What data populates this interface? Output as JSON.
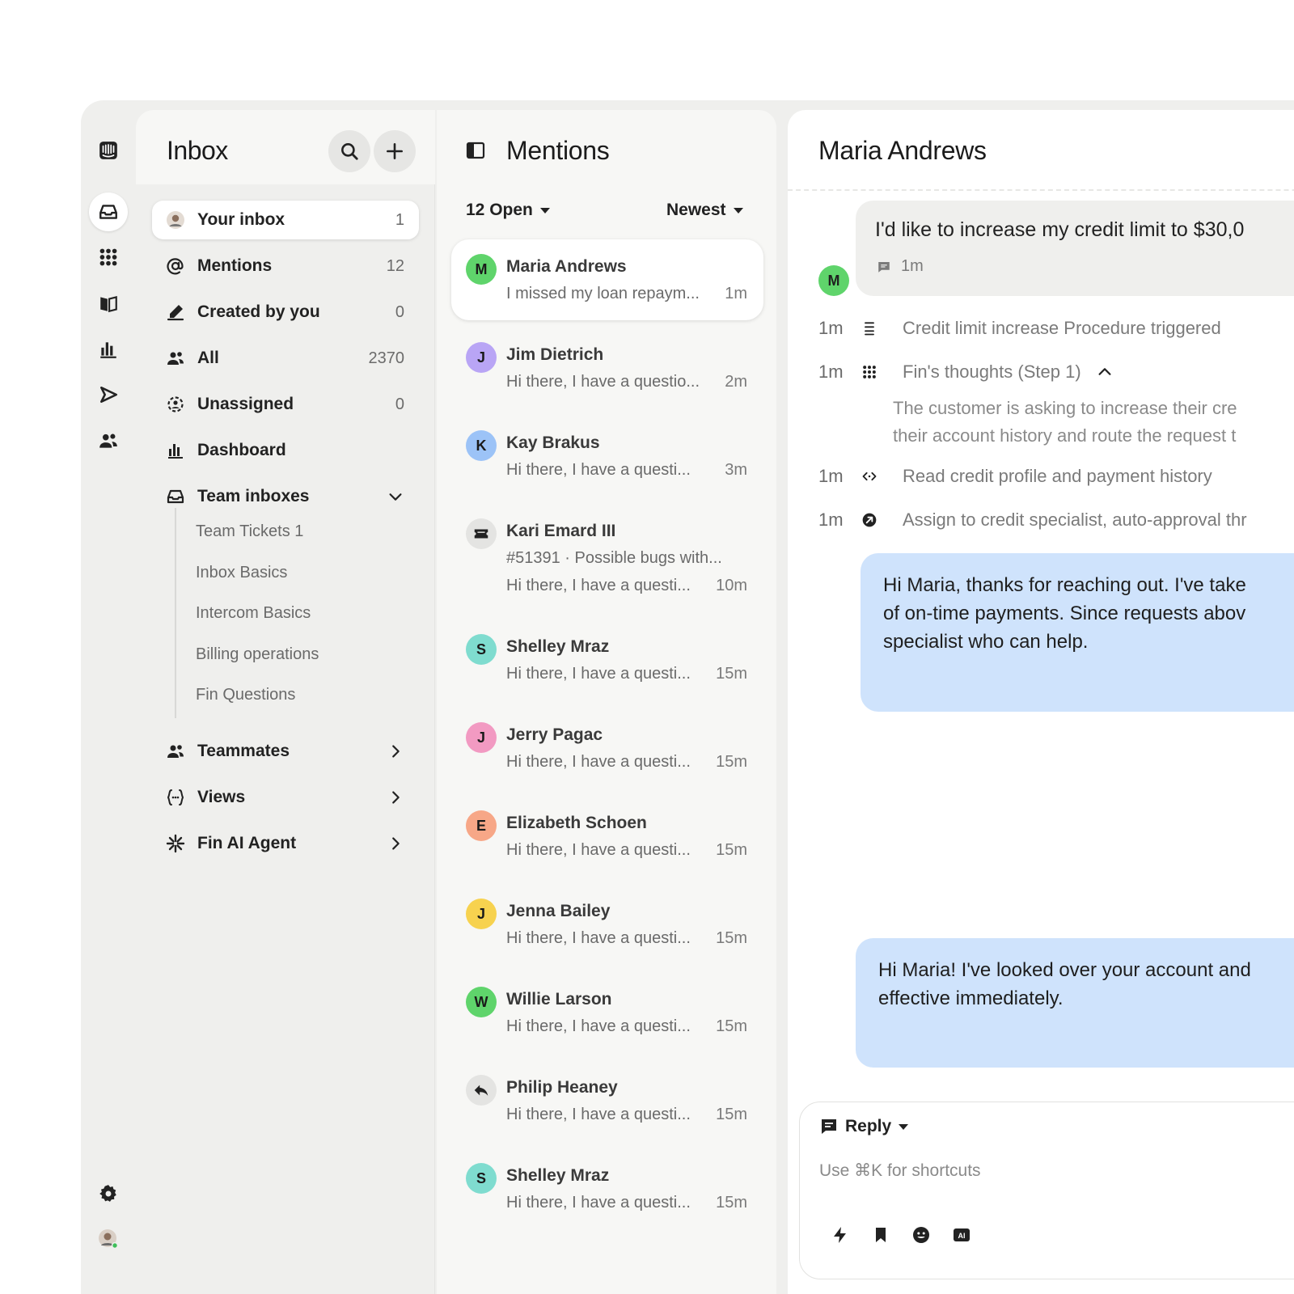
{
  "rail": {
    "icons": [
      "intercom-logo-icon",
      "inbox-icon",
      "fin-icon",
      "knowledge-book-icon",
      "reports-icon",
      "outbound-icon",
      "contacts-icon",
      "settings-icon",
      "user-avatar"
    ]
  },
  "nav": {
    "title": "Inbox",
    "items": [
      {
        "label": "Your inbox",
        "count": "1"
      },
      {
        "label": "Mentions",
        "count": "12"
      },
      {
        "label": "Created by you",
        "count": "0"
      },
      {
        "label": "All",
        "count": "2370"
      },
      {
        "label": "Unassigned",
        "count": "0"
      },
      {
        "label": "Dashboard",
        "count": ""
      },
      {
        "label": "Team inboxes",
        "count": ""
      }
    ],
    "team_inboxes": [
      "Team Tickets 1",
      "Inbox Basics",
      "Intercom Basics",
      "Billing operations",
      "Fin Questions"
    ],
    "groups": [
      {
        "label": "Teammates"
      },
      {
        "label": "Views"
      },
      {
        "label": "Fin AI Agent"
      }
    ]
  },
  "list": {
    "title": "Mentions",
    "filter_status": "12 Open",
    "filter_sort": "Newest",
    "conversations": [
      {
        "initial": "M",
        "name": "Maria Andrews",
        "preview": "I missed my loan repaym...",
        "time": "1m",
        "color": "#5fd46b"
      },
      {
        "initial": "J",
        "name": "Jim Dietrich",
        "preview": "Hi there, I have a questio...",
        "time": "2m",
        "color": "#b9a5f5"
      },
      {
        "initial": "K",
        "name": "Kay Brakus",
        "preview": "Hi there, I have a questi...",
        "time": "3m",
        "color": "#9cc3f7"
      },
      {
        "initial": "",
        "name": "Kari Emard III",
        "subject": "#51391 · Possible bugs with...",
        "preview": "Hi there, I have a questi...",
        "time": "10m",
        "color": "#e4e4e2"
      },
      {
        "initial": "S",
        "name": "Shelley Mraz",
        "preview": "Hi there, I have a questi...",
        "time": "15m",
        "color": "#7fdccf"
      },
      {
        "initial": "J",
        "name": "Jerry Pagac",
        "preview": "Hi there, I have a questi...",
        "time": "15m",
        "color": "#f29ac2"
      },
      {
        "initial": "E",
        "name": "Elizabeth Schoen",
        "preview": "Hi there, I have a questi...",
        "time": "15m",
        "color": "#f7a787"
      },
      {
        "initial": "J",
        "name": "Jenna Bailey",
        "preview": "Hi there, I have a questi...",
        "time": "15m",
        "color": "#f7d24f"
      },
      {
        "initial": "W",
        "name": "Willie Larson",
        "preview": "Hi there, I have a questi...",
        "time": "15m",
        "color": "#5fd46b"
      },
      {
        "initial": "",
        "name": "Philip Heaney",
        "preview": "Hi there, I have a questi...",
        "time": "15m",
        "color": "#e4e4e2"
      },
      {
        "initial": "S",
        "name": "Shelley Mraz",
        "preview": "Hi there, I have a questi...",
        "time": "15m",
        "color": "#7fdccf"
      }
    ]
  },
  "detail": {
    "title": "Maria Andrews",
    "customer_message": "I'd like to increase my credit limit to $30,0",
    "customer_message_time": "1m",
    "customer_initial": "M",
    "events": [
      {
        "time": "1m",
        "text": "Credit limit increase Procedure triggered"
      },
      {
        "time": "1m",
        "text": "Fin's thoughts (Step 1)"
      },
      {
        "time": "1m",
        "text": "Read credit profile and payment history"
      },
      {
        "time": "1m",
        "text": "Assign to credit specialist, auto-approval thr"
      }
    ],
    "thought_lines": [
      "The customer is asking to increase their cre",
      "their account history and route the request t"
    ],
    "bot_reply_1": [
      "Hi Maria, thanks for reaching out. I've take",
      "of on-time payments. Since requests abov",
      "specialist who can help."
    ],
    "bot_reply_2": [
      "Hi Maria! I've looked over your account and",
      "effective immediately."
    ],
    "composer": {
      "mode": "Reply",
      "placeholder": "Use ⌘K for shortcuts",
      "tools": [
        "lightning-icon",
        "bookmark-icon",
        "emoji-icon",
        "ai-icon"
      ]
    }
  }
}
